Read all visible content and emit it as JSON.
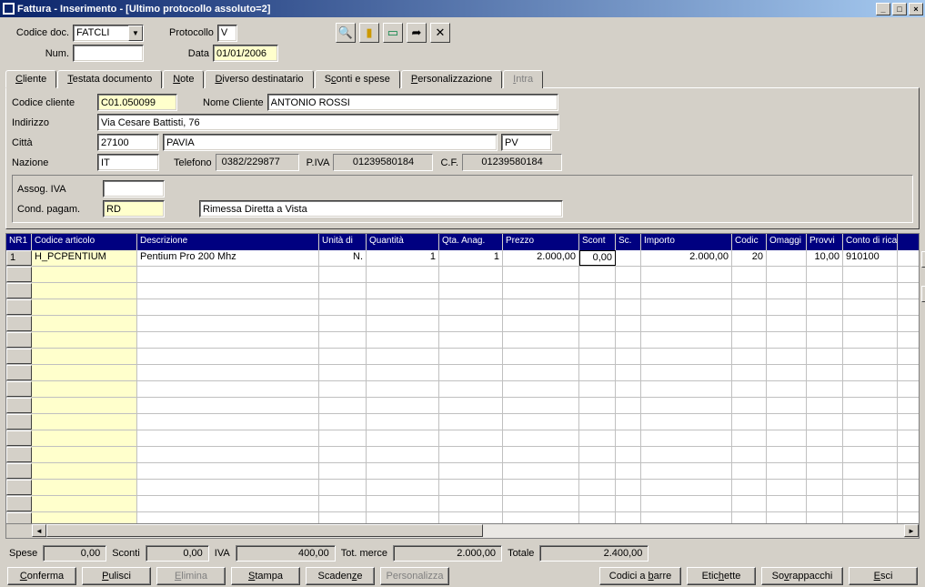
{
  "window": {
    "title": "Fattura - Inserimento - [Ultimo protocollo assoluto=2]"
  },
  "top": {
    "codice_doc_label": "Codice doc.",
    "codice_doc_value": "FATCLI",
    "protocollo_label": "Protocollo",
    "protocollo_value": "V",
    "num_label": "Num.",
    "num_value": "",
    "data_label": "Data",
    "data_value": "01/01/2006"
  },
  "tabs": {
    "cliente": "Cliente",
    "testata": "Testata documento",
    "note": "Note",
    "diverso": "Diverso destinatario",
    "sconti": "Sconti e spese",
    "person": "Personalizzazione",
    "intra": "Intra"
  },
  "client": {
    "codice_cliente_label": "Codice cliente",
    "codice_cliente": "C01.050099",
    "nome_cliente_label": "Nome Cliente",
    "nome_cliente": "ANTONIO ROSSI",
    "indirizzo_label": "Indirizzo",
    "indirizzo": "Via Cesare Battisti, 76",
    "citta_label": "Città",
    "cap": "27100",
    "citta": "PAVIA",
    "prov": "PV",
    "nazione_label": "Nazione",
    "nazione": "IT",
    "telefono_label": "Telefono",
    "telefono": "0382/229877",
    "piva_label": "P.IVA",
    "piva": "01239580184",
    "cf_label": "C.F.",
    "cf": "01239580184",
    "assog_label": "Assog. IVA",
    "assog": "",
    "cond_label": "Cond. pagam.",
    "cond": "RD",
    "cond_desc": "Rimessa Diretta a Vista"
  },
  "grid": {
    "headers": [
      "NR1",
      "Codice articolo",
      "Descrizione",
      "Unità di",
      "Quantità",
      "Qta. Anag.",
      "Prezzo",
      "Scont",
      "Sc.",
      "Importo",
      "Codic",
      "Omaggi",
      "Provvi",
      "Conto di ricavo"
    ],
    "row": {
      "nr": "1",
      "codice": "H_PCPENTIUM",
      "descr": "Pentium Pro 200 Mhz",
      "unita": "N.",
      "qta": "1",
      "qta_anag": "1",
      "prezzo": "2.000,00",
      "scont": "0,00",
      "sc": "",
      "importo": "2.000,00",
      "codic": "20",
      "omaggi": "",
      "provvi": "10,00",
      "conto": "910100"
    }
  },
  "totals": {
    "spese_label": "Spese",
    "spese": "0,00",
    "sconti_label": "Sconti",
    "sconti": "0,00",
    "iva_label": "IVA",
    "iva": "400,00",
    "tot_merce_label": "Tot. merce",
    "tot_merce": "2.000,00",
    "totale_label": "Totale",
    "totale": "2.400,00"
  },
  "buttons": {
    "conferma": "Conferma",
    "pulisci": "Pulisci",
    "elimina": "Elimina",
    "stampa": "Stampa",
    "scadenze": "Scadenze",
    "personalizza": "Personalizza",
    "codici": "Codici a barre",
    "etichette": "Etichette",
    "sovrappacchi": "Sovrappacchi",
    "esci": "Esci"
  }
}
